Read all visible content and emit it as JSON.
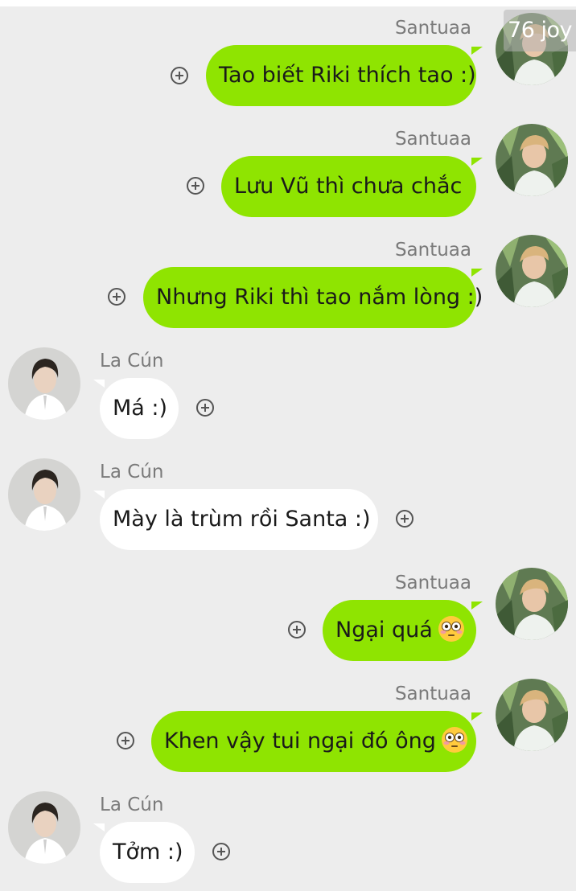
{
  "watermark": "76 joy",
  "names": {
    "santuaa": "Santuaa",
    "lacun": "La Cún"
  },
  "messages": [
    {
      "sender": "Santuaa",
      "text": "Tao biết Riki thích tao :)"
    },
    {
      "sender": "Santuaa",
      "text": "Lưu Vũ thì chưa chắc"
    },
    {
      "sender": "Santuaa",
      "text": "Nhưng Riki thì tao nắm lòng :)"
    },
    {
      "sender": "La Cún",
      "text": "Má :)"
    },
    {
      "sender": "La Cún",
      "text": "Mày là trùm rồi Santa :)"
    },
    {
      "sender": "Santuaa",
      "text": "Ngại quá",
      "emoji": "flushed-face"
    },
    {
      "sender": "Santuaa",
      "text": "Khen vậy tui ngại đó ông",
      "emoji": "flushed-face"
    },
    {
      "sender": "La Cún",
      "text": "Tởm :)"
    }
  ],
  "colors": {
    "outgoing_bubble": "#8fe401",
    "incoming_bubble": "#ffffff",
    "background": "#ededed"
  }
}
